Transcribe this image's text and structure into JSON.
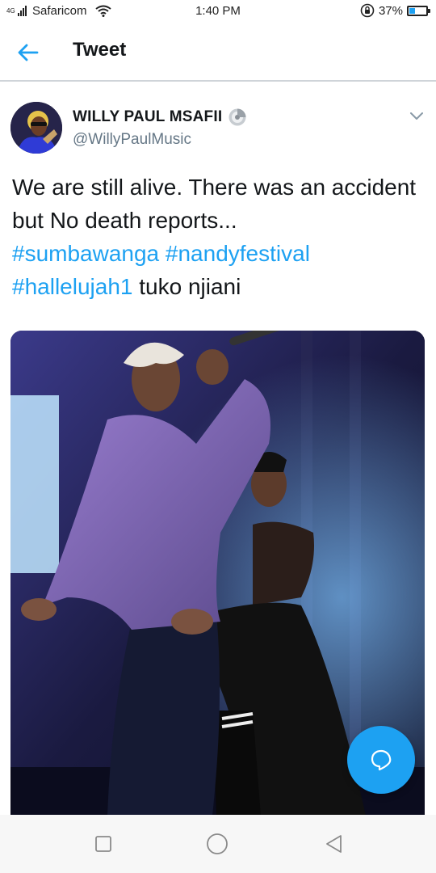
{
  "status_bar": {
    "network_badge": "4G",
    "carrier": "Safaricom",
    "time": "1:40 PM",
    "battery_text": "37%",
    "battery_level": 0.37,
    "icons": [
      "signal-icon",
      "wifi-icon",
      "rotation-lock-icon",
      "battery-icon"
    ]
  },
  "header": {
    "title": "Tweet",
    "back_icon": "arrow-left-icon"
  },
  "tweet": {
    "author_name": "WILLY PAUL MSAFII",
    "author_handle": "@WillyPaulMusic",
    "verified_icon": "disc-badge-icon",
    "menu_icon": "chevron-down-icon",
    "text_plain_1": "We are still alive. There was an accident but No death reports...",
    "hashtags": [
      "#sumbawanga",
      "#nandyfestival",
      "#hallelujah1"
    ],
    "text_plain_2": "tuko njiani"
  },
  "compose_button": {
    "icon": "reply-bubble-icon"
  },
  "nav_bar": {
    "items": [
      "recent-apps-icon",
      "home-icon",
      "back-triangle-icon"
    ]
  },
  "colors": {
    "accent": "#1da1f2",
    "text_primary": "#14171a",
    "text_secondary": "#657786",
    "divider": "#cfd4d9"
  }
}
